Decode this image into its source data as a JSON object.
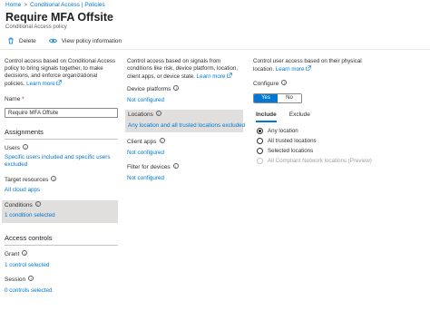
{
  "breadcrumb": {
    "items": [
      "Home",
      "Conditional Access | Policies"
    ],
    "separator": ">"
  },
  "header": {
    "title": "Require MFA Offsite",
    "more": "···",
    "subtitle": "Conditional Access policy"
  },
  "commands": {
    "delete": "Delete",
    "view_info": "View policy information"
  },
  "col1": {
    "desc": "Control access based on Conditional Access policy to bring signals together, to make decisions, and enforce organizational policies.",
    "learn_more": "Learn more",
    "name_label": "Name",
    "required_mark": "*",
    "name_value": "Require MFA Offsite",
    "assignments_heading": "Assignments",
    "users_label": "Users",
    "users_value": "Specific users included and specific users excluded",
    "target_label": "Target resources",
    "target_value": "All cloud apps",
    "conditions_label": "Conditions",
    "conditions_value": "1 condition selected",
    "access_controls_heading": "Access controls",
    "grant_label": "Grant",
    "grant_value": "1 control selected",
    "session_label": "Session",
    "session_value": "0 controls selected"
  },
  "col2": {
    "desc": "Control access based on signals from conditions like risk, device platform, location, client apps, or device state.",
    "learn_more": "Learn more",
    "device_platforms_label": "Device platforms",
    "device_platforms_value": "Not configured",
    "locations_label": "Locations",
    "locations_value": "Any location and all trusted locations excluded",
    "client_apps_label": "Client apps",
    "client_apps_value": "Not configured",
    "filter_label": "Filter for devices",
    "filter_value": "Not configured"
  },
  "col3": {
    "desc": "Control user access based on their physical location.",
    "learn_more": "Learn more",
    "configure_label": "Configure",
    "toggle_yes": "Yes",
    "toggle_no": "No",
    "tab_include": "Include",
    "tab_exclude": "Exclude",
    "options": [
      {
        "label": "Any location",
        "selected": true,
        "disabled": false
      },
      {
        "label": "All trusted locations",
        "selected": false,
        "disabled": false
      },
      {
        "label": "Selected locations",
        "selected": false,
        "disabled": false
      },
      {
        "label": "All Compliant Network locations (Preview)",
        "selected": false,
        "disabled": true
      }
    ]
  },
  "colors": {
    "accent": "#0078d4",
    "selected_bg": "#e1dfdd",
    "required": "#a4262c"
  }
}
